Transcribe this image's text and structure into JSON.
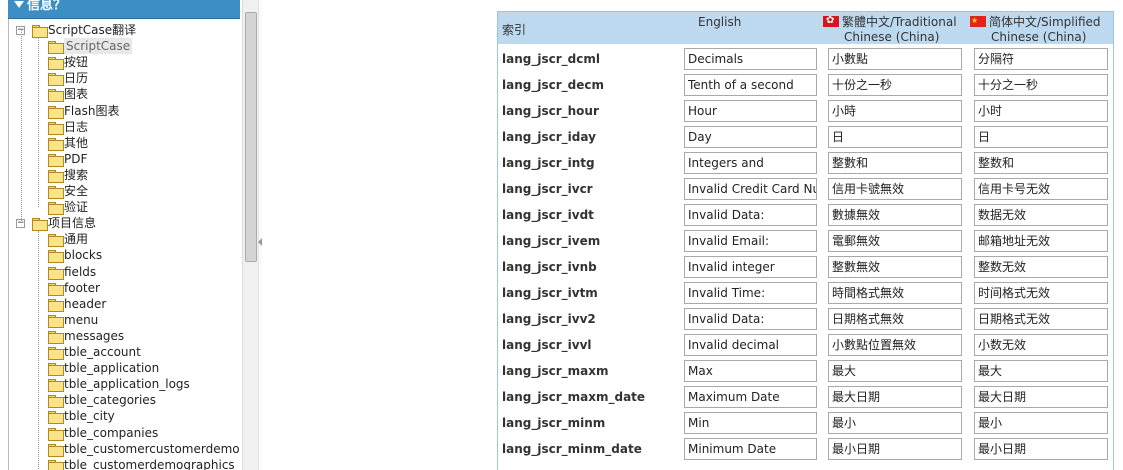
{
  "panel": {
    "title": "信息？"
  },
  "tree": [
    {
      "label": "ScriptCase翻译",
      "level": 0,
      "expandable": true
    },
    {
      "label": "ScriptCase",
      "level": 1,
      "selected": true
    },
    {
      "label": "按钮",
      "level": 1
    },
    {
      "label": "日历",
      "level": 1
    },
    {
      "label": "图表",
      "level": 1
    },
    {
      "label": "Flash图表",
      "level": 1
    },
    {
      "label": "日志",
      "level": 1
    },
    {
      "label": "其他",
      "level": 1
    },
    {
      "label": "PDF",
      "level": 1
    },
    {
      "label": "搜索",
      "level": 1
    },
    {
      "label": "安全",
      "level": 1
    },
    {
      "label": "验证",
      "level": 1
    },
    {
      "label": "项目信息",
      "level": 0,
      "expandable": true
    },
    {
      "label": "通用",
      "level": 1
    },
    {
      "label": "blocks",
      "level": 1
    },
    {
      "label": "fields",
      "level": 1
    },
    {
      "label": "footer",
      "level": 1
    },
    {
      "label": "header",
      "level": 1
    },
    {
      "label": "menu",
      "level": 1
    },
    {
      "label": "messages",
      "level": 1
    },
    {
      "label": "tble_account",
      "level": 1
    },
    {
      "label": "tble_application",
      "level": 1
    },
    {
      "label": "tble_application_logs",
      "level": 1
    },
    {
      "label": "tble_categories",
      "level": 1
    },
    {
      "label": "tble_city",
      "level": 1
    },
    {
      "label": "tble_companies",
      "level": 1
    },
    {
      "label": "tble_customercustomerdemo",
      "level": 1
    },
    {
      "label": "tble_customerdemographics",
      "level": 1
    }
  ],
  "table": {
    "headers": {
      "index": "索引",
      "english": "English",
      "traditional_1": "繁體中文/Traditional",
      "traditional_2": "Chinese (China)",
      "simplified_1": "简体中文/Simplified",
      "simplified_2": "Chinese (China)"
    },
    "rows": [
      {
        "key": "lang_jscr_dcml",
        "en": "Decimals",
        "tw": "小數點",
        "cn": "分隔符"
      },
      {
        "key": "lang_jscr_decm",
        "en": "Tenth of a second",
        "tw": "十份之一秒",
        "cn": "十分之一秒"
      },
      {
        "key": "lang_jscr_hour",
        "en": "Hour",
        "tw": "小時",
        "cn": "小时"
      },
      {
        "key": "lang_jscr_iday",
        "en": "Day",
        "tw": "日",
        "cn": "日"
      },
      {
        "key": "lang_jscr_intg",
        "en": "Integers and",
        "tw": "整數和",
        "cn": "整数和"
      },
      {
        "key": "lang_jscr_ivcr",
        "en": "Invalid Credit Card Num",
        "tw": "信用卡號無效",
        "cn": "信用卡号无效"
      },
      {
        "key": "lang_jscr_ivdt",
        "en": "Invalid Data:",
        "tw": "數據無效",
        "cn": "数据无效"
      },
      {
        "key": "lang_jscr_ivem",
        "en": "Invalid Email:",
        "tw": "電郵無效",
        "cn": "邮箱地址无效"
      },
      {
        "key": "lang_jscr_ivnb",
        "en": "Invalid integer",
        "tw": "整數無效",
        "cn": "整数无效"
      },
      {
        "key": "lang_jscr_ivtm",
        "en": "Invalid Time:",
        "tw": "時間格式無效",
        "cn": "时间格式无效"
      },
      {
        "key": "lang_jscr_ivv2",
        "en": "Invalid Data:",
        "tw": "日期格式無效",
        "cn": "日期格式无效"
      },
      {
        "key": "lang_jscr_ivvl",
        "en": "Invalid decimal",
        "tw": "小數點位置無效",
        "cn": "小数无效"
      },
      {
        "key": "lang_jscr_maxm",
        "en": "Max",
        "tw": "最大",
        "cn": "最大"
      },
      {
        "key": "lang_jscr_maxm_date",
        "en": "Maximum Date",
        "tw": "最大日期",
        "cn": "最大日期"
      },
      {
        "key": "lang_jscr_minm",
        "en": "Min",
        "tw": "最小",
        "cn": "最小"
      },
      {
        "key": "lang_jscr_minm_date",
        "en": "Minimum Date",
        "tw": "最小日期",
        "cn": "最小日期"
      }
    ]
  }
}
